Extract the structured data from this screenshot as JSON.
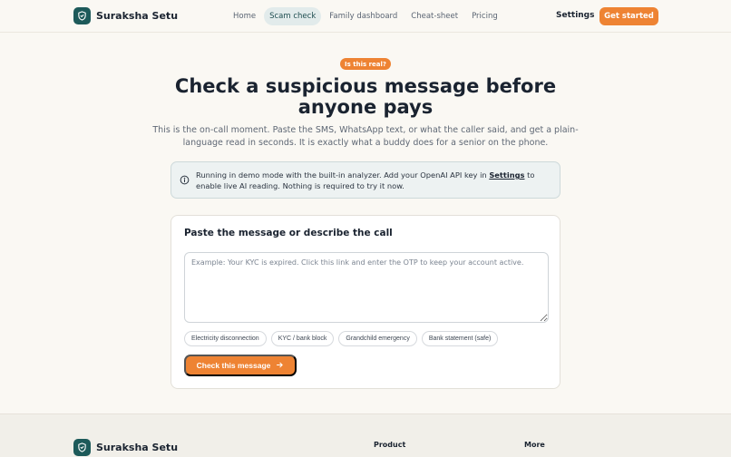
{
  "app": {
    "name": "Suraksha Setu",
    "logo_icon": "shield-icon"
  },
  "nav": {
    "items": [
      {
        "label": "Home",
        "active": false
      },
      {
        "label": "Scam check",
        "active": true
      },
      {
        "label": "Family dashboard",
        "active": false
      },
      {
        "label": "Cheat-sheet",
        "active": false
      },
      {
        "label": "Pricing",
        "active": false
      }
    ],
    "settings_label": "Settings",
    "cta_label": "Get started"
  },
  "hero": {
    "badge": "Is this real?",
    "title": "Check a suspicious message before anyone pays",
    "subtitle": "This is the on-call moment. Paste the SMS, WhatsApp text, or what the caller said, and get a plain-language read in seconds. It is exactly what a buddy does for a senior on the phone."
  },
  "banner": {
    "icon": "info-icon",
    "text_before": "Running in demo mode with the built-in analyzer. Add your OpenAI API key in ",
    "link": "Settings",
    "text_after": " to enable live AI reading. Nothing is required to try it now."
  },
  "form": {
    "title": "Paste the message or describe the call",
    "value": "",
    "placeholder": "Example: Your KYC is expired. Click this link and enter the OTP to keep your account active.",
    "chips": [
      "Electricity disconnection",
      "KYC / bank block",
      "Grandchild emergency",
      "Bank statement (safe)"
    ],
    "submit_label": "Check this message",
    "submit_icon": "arrow-right-icon"
  },
  "footer": {
    "brand": "Suraksha Setu",
    "headings": [
      "Product",
      "More"
    ]
  },
  "colors": {
    "accent": "#ee8333",
    "brand": "#1d5a5a",
    "background": "#faf8f3",
    "banner_bg": "#edf2f2"
  }
}
